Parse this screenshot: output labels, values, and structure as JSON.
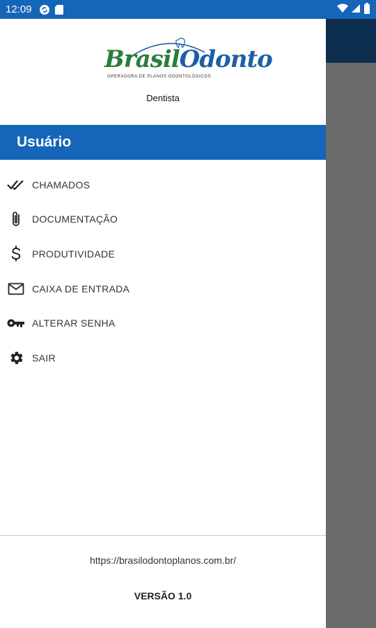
{
  "status_bar": {
    "time": "12:09",
    "icons_left": [
      "sync-icon",
      "sd-card-icon"
    ],
    "icons_right": [
      "wifi-icon",
      "signal-icon",
      "battery-icon"
    ]
  },
  "logo": {
    "brand_part1": "Brasil",
    "brand_part2": "Odonto",
    "tagline": "OPERADORA DE PLANOS ODONTOLÓGICOS"
  },
  "drawer": {
    "role": "Dentista",
    "section_title": "Usuário",
    "items": [
      {
        "label": "CHAMADOS",
        "icon": "double-check-icon"
      },
      {
        "label": "DOCUMENTAÇÃO",
        "icon": "paperclip-icon"
      },
      {
        "label": "PRODUTIVIDADE",
        "icon": "dollar-icon"
      },
      {
        "label": "CAIXA DE ENTRADA",
        "icon": "mail-icon"
      },
      {
        "label": "ALTERAR SENHA",
        "icon": "key-icon"
      },
      {
        "label": "SAIR",
        "icon": "gear-icon"
      }
    ],
    "footer_url": "https://brasilodontoplanos.com.br/",
    "version": "VERSÃO 1.0"
  },
  "colors": {
    "status_bar": "#1565b8",
    "section_bar": "#1565b8",
    "brand_green": "#2b7d3a",
    "brand_blue": "#1c5fa6",
    "scrim": "#6b6b6b",
    "app_toolbar": "#0d2e4e"
  }
}
